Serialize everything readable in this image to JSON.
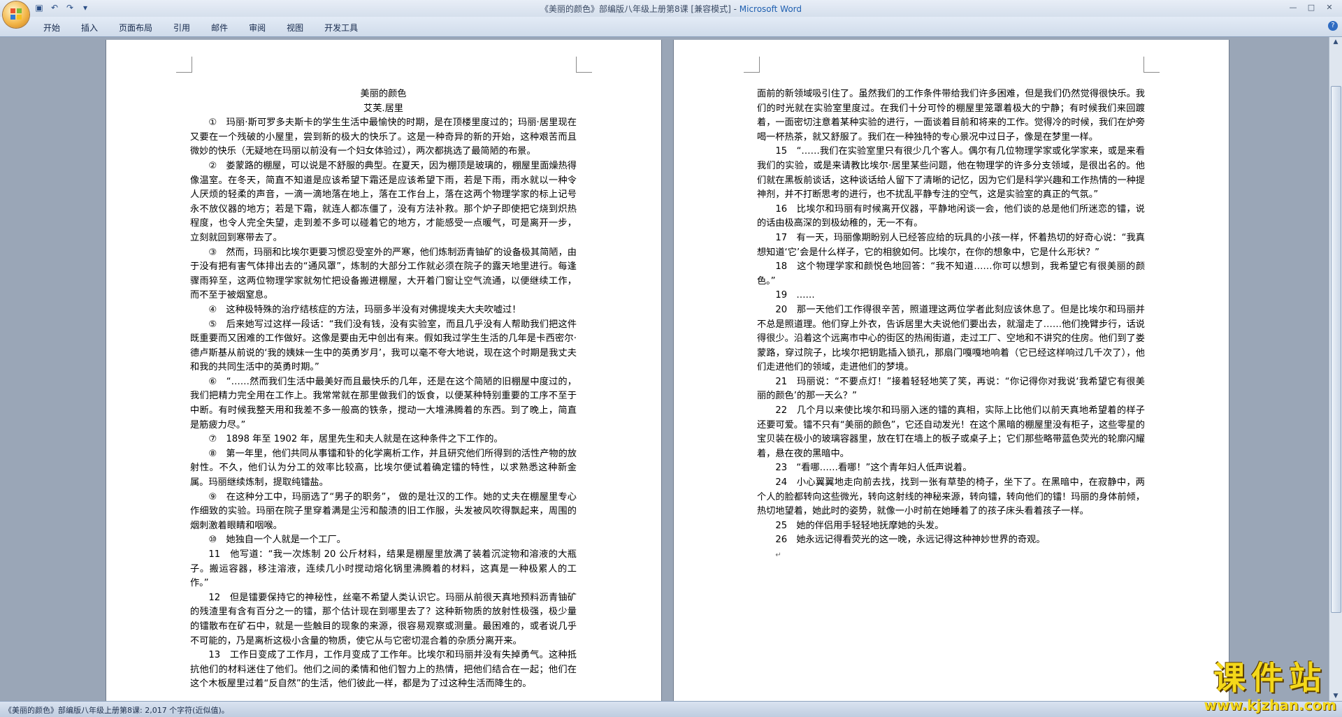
{
  "window": {
    "title": "《美丽的颜色》部编版八年级上册第8课 [兼容模式] - ",
    "app_name": "Microsoft Word"
  },
  "ribbon": {
    "tabs": [
      "开始",
      "插入",
      "页面布局",
      "引用",
      "邮件",
      "审阅",
      "视图",
      "开发工具"
    ]
  },
  "document": {
    "title": "美丽的颜色",
    "author": "艾芙.居里",
    "left_paragraphs": [
      "①　玛丽·斯可罗多夫斯卡的学生生活中最愉快的时期，是在顶楼里度过的；玛丽·居里现在又要在一个残破的小屋里，尝到新的极大的快乐了。这是一种奇异的新的开始，这种艰苦而且微妙的快乐（无疑地在玛丽以前没有一个妇女体验过），两次都挑选了最简陋的布景。",
      "②　娄蒙路的棚屋，可以说是不舒服的典型。在夏天，因为棚顶是玻璃的，棚屋里面燥热得像温室。在冬天，简直不知道是应该希望下霜还是应该希望下雨，若是下雨，雨水就以一种令人厌烦的轻柔的声音，一滴一滴地落在地上，落在工作台上，落在这两个物理学家的标上记号永不放仪器的地方；若是下霜，就连人都冻僵了，没有方法补救。那个炉子即使把它烧到炽热程度，也令人完全失望，走到差不多可以碰着它的地方，才能感受一点暖气，可是离开一步，立刻就回到寒带去了。",
      "③　然而，玛丽和比埃尔更要习惯忍受室外的严寒，他们炼制沥青铀矿的设备极其简陋，由于没有把有害气体排出去的“通风罩”，炼制的大部分工作就必须在院子的露天地里进行。每逢骤雨猝至，这两位物理学家就匆忙把设备搬进棚屋，大开着门窗让空气流通，以便继续工作，而不至于被烟窒息。",
      "④　这种极特殊的治疗结核症的方法，玛丽多半没有对佛提埃夫大夫吹嘘过！",
      "⑤　后来她写过这样一段话：“我们没有钱，没有实验室，而且几乎没有人帮助我们把这件既重要而又困难的工作做好。这像是要由无中创出有来。假如我过学生生活的几年是卡西密尔·德卢斯基从前说的‘我的姨妹一生中的英勇岁月’，我可以毫不夸大地说，现在这个时期是我丈夫和我的共同生活中的英勇时期。”",
      "⑥　“……然而我们生活中最美好而且最快乐的几年，还是在这个简陋的旧棚屋中度过的，我们把精力完全用在工作上。我常常就在那里做我们的饭食，以便某种特别重要的工序不至于中断。有时候我整天用和我差不多一般高的铁条，搅动一大堆沸腾着的东西。到了晚上，简直是筋疲力尽。”",
      "⑦　1898 年至 1902 年，居里先生和夫人就是在这种条件之下工作的。",
      "⑧　第一年里，他们共同从事镭和钋的化学离析工作，并且研究他们所得到的活性产物的放射性。不久，他们认为分工的效率比较高，比埃尔便试着确定镭的特性，以求熟悉这种新金属。玛丽继续炼制，提取纯镭盐。",
      "⑨　在这种分工中，玛丽选了“男子的职务”， 做的是壮汉的工作。她的丈夫在棚屋里专心作细致的实验。玛丽在院子里穿着满是尘污和酸渍的旧工作服，头发被风吹得飘起来，周围的烟刺激着眼睛和咽喉。",
      "⑩　她独自一个人就是一个工厂。",
      "11　他写道：“我一次炼制 20 公斤材料，结果是棚屋里放满了装着沉淀物和溶液的大瓶子。搬运容器，移注溶液，连续几小时搅动熔化锅里沸腾着的材料，这真是一种极累人的工作。”",
      "12　但是镭要保持它的神秘性，丝毫不希望人类认识它。玛丽从前很天真地预料沥青铀矿的残渣里有含有百分之一的镭，那个估计现在到哪里去了？这种新物质的放射性极强，极少量的镭散布在矿石中，就是一些触目的现象的来源，很容易观察或测量。最困难的，或者说几乎不可能的，乃是离析这极小含量的物质，使它从与它密切混合着的杂质分离开来。",
      "13　工作日变成了工作月，工作月变成了工作年。比埃尔和玛丽并没有失掉勇气。这种抵抗他们的材料迷住了他们。他们之间的柔情和他们智力上的热情，把他们结合在一起；他们在这个木板屋里过着“反自然”的生活，他们彼此一样，都是为了过这种生活而降生的。"
    ],
    "right_paragraphs": [
      "面前的新领域吸引住了。虽然我们的工作条件带给我们许多困难，但是我们仍然觉得很快乐。我们的时光就在实验室里度过。在我们十分可怜的棚屋里笼罩着极大的宁静；有时候我们来回踱着，一面密切注意着某种实验的进行，一面谈着目前和将来的工作。觉得冷的时候，我们在炉旁喝一杯热茶，就又舒服了。我们在一种独特的专心景况中过日子，像是在梦里一样。",
      "15　“……我们在实验室里只有很少几个客人。偶尔有几位物理学家或化学家来，或是来看我们的实验，或是来请教比埃尔·居里某些问题，他在物理学的许多分支领域，是很出名的。他们就在黑板前谈话，这种谈话给人留下了清晰的记忆，因为它们是科学兴趣和工作热情的一种提神剂，并不打断思考的进行，也不扰乱平静专注的空气，这是实验室的真正的气氛。”",
      "16　比埃尔和玛丽有时候离开仪器，平静地闲谈一会，他们谈的总是他们所迷恋的镭，说的话由极高深的到极幼稚的，无一不有。",
      "17　有一天，玛丽像期盼别人已经答应给的玩具的小孩一样，怀着热切的好奇心说：“我真想知道‘它’会是什么样子，它的相貌如何。比埃尔，在你的想象中，它是什么形状？”",
      "18　这个物理学家和颜悦色地回答：“我不知道……你可以想到，我希望它有很美丽的颜色。”",
      "19　……",
      "20　那一天他们工作得很辛苦，照道理这两位学者此刻应该休息了。但是比埃尔和玛丽并不总是照道理。他们穿上外衣，告诉居里大夫说他们要出去，就溜走了……他们挽臂步行，话说得很少。沿着这个远离市中心的街区的热闹街道，走过工厂、空地和不讲究的住房。他们到了娄蒙路，穿过院子，比埃尔把钥匙插入锁孔，那扇门嘎嘎地响着（它已经这样响过几千次了），他们走进他们的领域，走进他们的梦境。",
      "21　玛丽说：“不要点灯！”接着轻轻地笑了笑，再说：“你记得你对我说‘我希望它有很美丽的颜色’的那一天么？”",
      "22　几个月以来使比埃尔和玛丽入迷的镭的真相，实际上比他们以前天真地希望着的样子还要可爱。镭不只有“美丽的颜色”，它还自动发光！在这个黑暗的棚屋里没有柜子，这些零星的宝贝装在极小的玻璃容器里，放在钉在墙上的板子或桌子上；它们那些略带蓝色荧光的轮廓闪耀着，悬在夜的黑暗中。",
      "23　“看哪……看哪！”这个青年妇人低声说着。",
      "24　小心翼翼地走向前去找，找到一张有草垫的椅子，坐下了。在黑暗中，在寂静中，两个人的脸都转向这些微光，转向这射线的神秘来源，转向镭，转向他们的镭！玛丽的身体前倾，热切地望着，她此时的姿势，就像一小时前在她睡着了的孩子床头看着孩子一样。",
      "25　她的伴侣用手轻轻地抚摩她的头发。",
      "26　她永远记得看荧光的这一晚，永远记得这种神妙世界的奇观。"
    ]
  },
  "status": {
    "text": "《美丽的颜色》部编版八年级上册第8课: 2,017 个字符(近似值)。"
  },
  "watermark": {
    "main": "课件站",
    "url": "www.kjzhan.com"
  },
  "icons": [
    "office-button",
    "save-icon",
    "undo-icon",
    "redo-icon",
    "customize-qat-icon",
    "minimize-icon",
    "maximize-icon",
    "close-icon",
    "help-icon"
  ],
  "colors": {
    "title_app": "#1f5fb0",
    "watermark": "#f4d81a"
  }
}
